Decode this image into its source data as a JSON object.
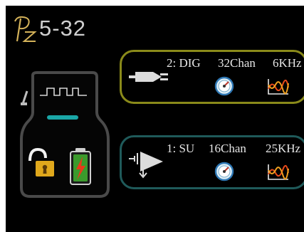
{
  "brand": {
    "logo_icon": "pz-monogram-logo",
    "model": "5-32"
  },
  "device": {
    "status_icons": [
      "probe-icon",
      "square-wave-icon",
      "unlock-icon",
      "battery-charging-icon"
    ]
  },
  "channels": [
    {
      "id": "2: DIG",
      "channel_count": "32Chan",
      "rate": "6KHz",
      "connector_icon": "digital-plug-icon",
      "gauge_icon": "gauge-icon",
      "signal_icon": "signal-wave-icon",
      "border_color": "#8a8a1a"
    },
    {
      "id": "1: SU",
      "channel_count": "16Chan",
      "rate": "25KHz",
      "connector_icon": "amplifier-icon",
      "gauge_icon": "gauge-icon",
      "signal_icon": "signal-wave-icon",
      "border_color": "#1f5a5a"
    }
  ],
  "colors": {
    "background": "#000000",
    "logo": "#d4b25a",
    "model_text": "#cfcfcf",
    "indicator": "#1aa7a7",
    "lock_body": "#e0a81c",
    "battery_fill": "#3b9a2c",
    "bolt": "#e83a1a"
  }
}
